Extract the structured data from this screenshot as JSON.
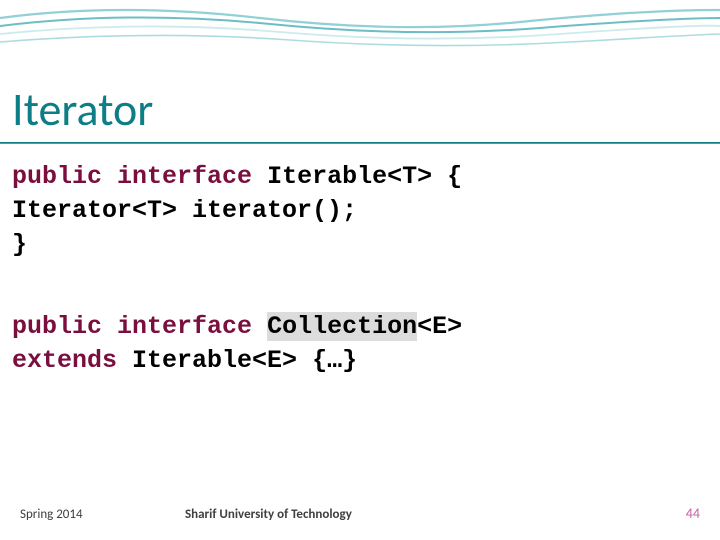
{
  "title": "Iterator",
  "code1": {
    "line1_kw1": "public",
    "line1_kw2": "interface",
    "line1_rest": " Iterable<T> {",
    "line2": "  Iterator<T> iterator();",
    "line3": "}"
  },
  "code2": {
    "line1_kw1": "public",
    "line1_kw2": "interface",
    "line1_name": "Collection",
    "line1_rest": "<E>",
    "line2_indent": "  ",
    "line2_kw": "extends",
    "line2_rest": " Iterable<E> {…}"
  },
  "footer": {
    "left": "Spring 2014",
    "center": "Sharif University of Technology",
    "page": "44"
  }
}
